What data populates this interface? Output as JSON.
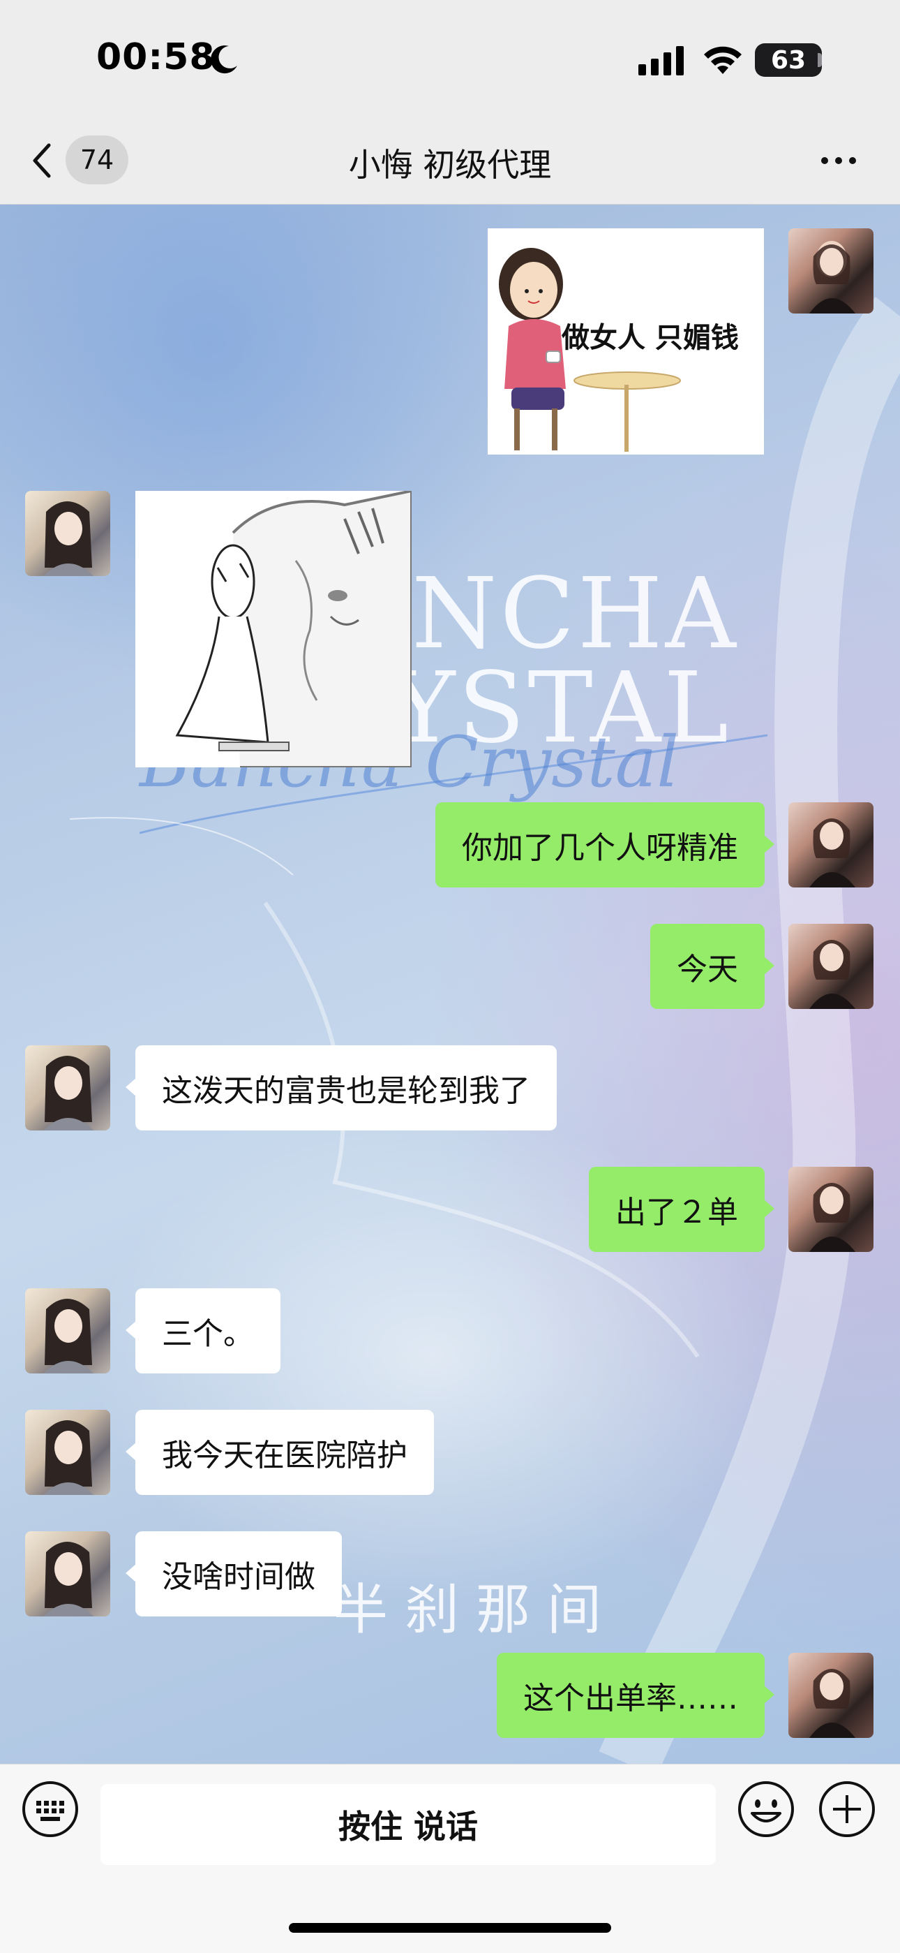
{
  "status_bar": {
    "time": "00:58",
    "battery": "63",
    "icons": [
      "moon-icon",
      "cellular-signal-icon",
      "wifi-icon",
      "battery-icon"
    ]
  },
  "nav": {
    "back_icon": "chevron-left-icon",
    "unread_count": "74",
    "title": "小悔 初级代理",
    "more_icon": "ellipsis-icon"
  },
  "background": {
    "watermark_line1": "NCHA",
    "watermark_line2": "YSTAL",
    "watermark_script": "Bancha Crystal",
    "watermark_cn": "半刹那间"
  },
  "messages": [
    {
      "sender": "me",
      "type": "sticker",
      "caption": "做女人 只媚钱"
    },
    {
      "sender": "other",
      "type": "sticker",
      "caption": ""
    },
    {
      "sender": "me",
      "type": "text",
      "text": "你加了几个人呀精准"
    },
    {
      "sender": "me",
      "type": "text",
      "text": "今天"
    },
    {
      "sender": "other",
      "type": "text",
      "text": "这泼天的富贵也是轮到我了"
    },
    {
      "sender": "me",
      "type": "text",
      "text": "出了２单"
    },
    {
      "sender": "other",
      "type": "text",
      "text": "三个。"
    },
    {
      "sender": "other",
      "type": "text",
      "text": "我今天在医院陪护"
    },
    {
      "sender": "other",
      "type": "text",
      "text": "没啥时间做"
    },
    {
      "sender": "me",
      "type": "text",
      "text": "这个出单率……"
    }
  ],
  "input_bar": {
    "hold_to_talk": "按住 说话",
    "icons": [
      "keyboard-icon",
      "emoji-icon",
      "plus-icon"
    ]
  },
  "colors": {
    "my_bubble": "#95ec69",
    "other_bubble": "#ffffff",
    "bar_bg": "#ededed"
  }
}
